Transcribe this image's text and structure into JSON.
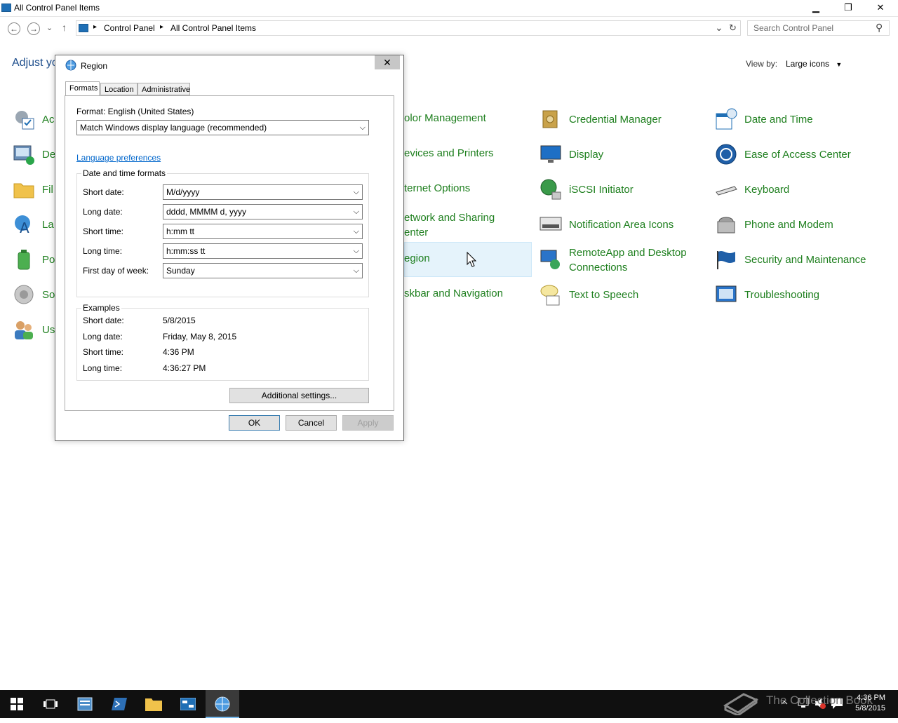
{
  "window": {
    "title": "All Control Panel Items",
    "minimize": "▁",
    "maximize": "❐",
    "close": "✕"
  },
  "address": {
    "crumbs": [
      "Control Panel",
      "All Control Panel Items"
    ],
    "sep": "▸",
    "dropdown": "⌄",
    "refresh": "↻"
  },
  "search": {
    "placeholder": "Search Control Panel",
    "icon": "⚲"
  },
  "nav": {
    "back": "←",
    "forward": "→",
    "recent": "⌄",
    "up": "↑"
  },
  "main": {
    "heading_partial": "Adjust yo",
    "view_by_label": "View by:",
    "view_by_value": "Large icons",
    "left_col_partial": [
      "Ac",
      "De",
      "Fil",
      "La",
      "Po",
      "So",
      "Us"
    ],
    "mid_col_partial": [
      "olor Management",
      "evices and Printers",
      "ternet Options",
      "etwork and Sharing",
      "enter",
      "egion",
      "skbar and Navigation"
    ],
    "col3": [
      "Credential Manager",
      "Display",
      "iSCSI Initiator",
      "Notification Area Icons",
      "RemoteApp and Desktop",
      "Connections",
      "Text to Speech"
    ],
    "col4": [
      "Date and Time",
      "Ease of Access Center",
      "Keyboard",
      "Phone and Modem",
      "Security and Maintenance",
      "Troubleshooting"
    ]
  },
  "dialog": {
    "title": "Region",
    "close": "✕",
    "tabs": [
      "Formats",
      "Location",
      "Administrative"
    ],
    "format_label": "Format: English (United States)",
    "format_value": "Match Windows display language (recommended)",
    "language_link": "Language preferences",
    "dt_group": "Date and time formats",
    "fields": [
      {
        "label": "Short date:",
        "value": "M/d/yyyy"
      },
      {
        "label": "Long date:",
        "value": "dddd, MMMM d, yyyy"
      },
      {
        "label": "Short time:",
        "value": "h:mm tt"
      },
      {
        "label": "Long time:",
        "value": "h:mm:ss tt"
      },
      {
        "label": "First day of week:",
        "value": "Sunday"
      }
    ],
    "examples_group": "Examples",
    "examples": [
      {
        "label": "Short date:",
        "value": "5/8/2015"
      },
      {
        "label": "Long date:",
        "value": "Friday, May 8, 2015"
      },
      {
        "label": "Short time:",
        "value": "4:36 PM"
      },
      {
        "label": "Long time:",
        "value": "4:36:27 PM"
      }
    ],
    "additional": "Additional settings...",
    "ok": "OK",
    "cancel": "Cancel",
    "apply": "Apply"
  },
  "taskbar": {
    "watermark": "The Collection Book",
    "time": "4:36 PM",
    "date": "5/8/2015"
  },
  "colors": {
    "link_green": "#1e7f1e",
    "heading_blue": "#1e4e8c",
    "hover": "#e5f3fb"
  }
}
